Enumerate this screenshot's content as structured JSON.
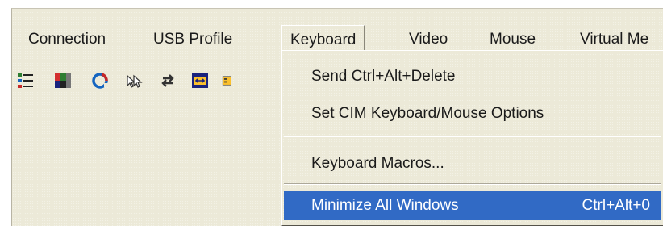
{
  "menubar": {
    "items": [
      {
        "label": "Connection"
      },
      {
        "label": "USB Profile"
      },
      {
        "label": "Keyboard"
      },
      {
        "label": "Video"
      },
      {
        "label": "Mouse"
      },
      {
        "label": "Virtual Me"
      }
    ],
    "open_menu": "Keyboard"
  },
  "toolbar": {
    "icons": [
      "properties-list-icon",
      "color-calibration-icon",
      "refresh-icon",
      "single-cursor-icon",
      "sync-arrows-icon",
      "fit-to-window-icon",
      "partially-hidden-icon"
    ]
  },
  "keyboard_menu": {
    "items": [
      {
        "label": "Send Ctrl+Alt+Delete",
        "shortcut": ""
      },
      {
        "label": "Set CIM Keyboard/Mouse Options",
        "shortcut": ""
      },
      {
        "label": "Keyboard Macros...",
        "shortcut": ""
      },
      {
        "label": "Minimize All Windows",
        "shortcut": "Ctrl+Alt+0",
        "selected": true
      }
    ]
  },
  "colors": {
    "chrome": "#ece9d8",
    "highlight": "#316ac5",
    "highlight_text": "#ffffff",
    "text": "#1a1a1a"
  }
}
